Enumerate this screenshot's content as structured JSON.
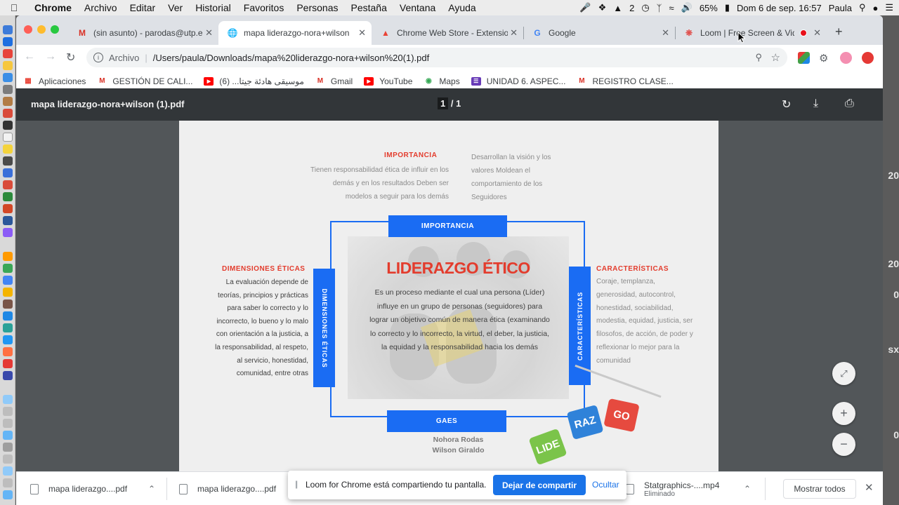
{
  "menubar": {
    "app": "Chrome",
    "items": [
      "Archivo",
      "Editar",
      "Ver",
      "Historial",
      "Favoritos",
      "Personas",
      "Pestaña",
      "Ventana",
      "Ayuda"
    ],
    "adobe_badge": "2",
    "battery": "65%",
    "datetime": "Dom 6 de sep. 16:57",
    "user": "Paula"
  },
  "desktop": {
    "numbers": [
      "20",
      "20",
      "0",
      "sx",
      "0"
    ]
  },
  "tabs": [
    {
      "title": "(sin asunto) - parodas@utp.e",
      "icon": "gmail-icon"
    },
    {
      "title": "mapa liderazgo-nora+wilson",
      "icon": "globe-icon"
    },
    {
      "title": "Chrome Web Store - Extensio",
      "icon": "webstore-icon"
    },
    {
      "title": "Google",
      "icon": "google-icon"
    },
    {
      "title": "Loom | Free Screen & Vid",
      "icon": "loom-icon"
    }
  ],
  "address": {
    "scheme": "Archivo",
    "url": "/Users/paula/Downloads/mapa%20liderazgo-nora+wilson%20(1).pdf"
  },
  "bookmarks": [
    {
      "label": "Aplicaciones",
      "icon": "apps-grid-icon"
    },
    {
      "label": "GESTIÓN DE CALI...",
      "icon": "gmail-icon"
    },
    {
      "label": "موسيقى هادئة جيتا... (6)",
      "icon": "youtube-icon"
    },
    {
      "label": "Gmail",
      "icon": "gmail-icon"
    },
    {
      "label": "YouTube",
      "icon": "youtube-icon"
    },
    {
      "label": "Maps",
      "icon": "maps-icon"
    },
    {
      "label": "UNIDAD 6. ASPEC...",
      "icon": "forms-icon"
    },
    {
      "label": "REGISTRO CLASE...",
      "icon": "gmail-icon"
    }
  ],
  "pdf": {
    "filename": "mapa liderazgo-nora+wilson (1).pdf",
    "page_current": "1",
    "page_total": "/ 1",
    "content": {
      "top_title": "IMPORTANCIA",
      "top_left_text": "Tienen responsabilidad ética de influir en los demás y en los resultados Deben ser modelos a seguir para los demás",
      "top_right_text": "Desarrollan la visión y los valores Moldean el comportamiento de los Seguidores",
      "pill_top": "IMPORTANCIA",
      "pill_bottom": "GAES",
      "pill_left": "DIMENSIONES ÉTICAS",
      "pill_right": "CARACTERÍSTICAS",
      "main_title": "LIDERAZGO ÉTICO",
      "main_text": "Es un proceso mediante el cual una persona (Líder) influye en un grupo de personas (seguidores) para lograr un objetivo común de manera ética (examinando lo correcto y lo incorrecto, la virtud, el deber, la justicia, la equidad y la responsabilidad hacia los demás",
      "left_title": "DIMENSIONES ÉTICAS",
      "left_text": "La evaluación depende de teorías, principios y prácticas para saber lo correcto y lo incorrecto, lo bueno y lo malo con orientación a la justicia, a la responsabilidad, al respeto, al servicio, honestidad, comunidad, entre otras",
      "right_title": "CARACTERÍSTICAS",
      "right_text": "Coraje, templanza, generosidad, autocontrol, honestidad, sociabilidad, modestia, equidad, justicia, ser filosofos, de acción, de poder y reflexionar lo mejor para la comunidad",
      "author_1": "Nohora Rodas",
      "author_2": "Wilson Giraldo",
      "cubes": [
        "LIDE",
        "RAZ",
        "GO"
      ]
    }
  },
  "downloads": [
    {
      "name": "mapa liderazgo....pdf"
    },
    {
      "name": "mapa liderazgo....pdf"
    },
    {
      "name": "Statgraphics-....mp4",
      "status": "Eliminado"
    }
  ],
  "download_show_all": "Mostrar todos",
  "loom_banner": {
    "message": "Loom for Chrome está compartiendo tu pantalla.",
    "stop_label": "Dejar de compartir",
    "hide_label": "Ocultar"
  },
  "colors": {
    "accent_blue": "#1a6cf3",
    "title_red": "#e33c2d",
    "pdf_toolbar": "#323639",
    "pdf_background": "#525659"
  }
}
